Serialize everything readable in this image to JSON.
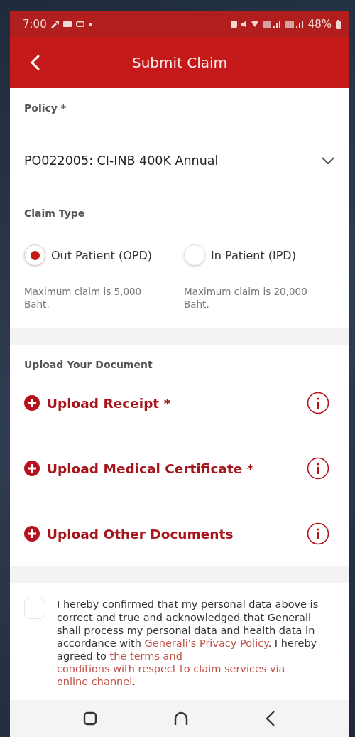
{
  "status_bar": {
    "time": "7:00",
    "battery": "48%"
  },
  "header": {
    "title": "Submit Claim"
  },
  "policy": {
    "label": "Policy *",
    "value": "PO022005: CI-INB 400K Annual"
  },
  "claim_type": {
    "label": "Claim Type",
    "options": [
      {
        "label": "Out Patient (OPD)",
        "note": "Maximum claim is 5,000 Baht.",
        "selected": true
      },
      {
        "label": "In Patient (IPD)",
        "note": "Maximum claim is 20,000 Baht.",
        "selected": false
      }
    ]
  },
  "upload": {
    "label": "Upload Your Document",
    "items": [
      {
        "label": "Upload Receipt *"
      },
      {
        "label": "Upload Medical Certificate *"
      },
      {
        "label": "Upload Other Documents"
      }
    ]
  },
  "consent": {
    "checked": false,
    "parts": [
      {
        "kind": "plain",
        "text": "I hereby confirmed that my personal data above is correct and true and acknowledged that Generali shall process my personal data and health data in accordance with "
      },
      {
        "kind": "link",
        "text": "Generali's"
      },
      {
        "kind": "link",
        "text": "Privacy Policy"
      },
      {
        "kind": "plain",
        "text": ". I hereby agreed to "
      },
      {
        "kind": "link",
        "text": "the terms and"
      },
      {
        "kind": "link",
        "text": "conditions with respect to claim services via"
      },
      {
        "kind": "link",
        "text": "online channel"
      },
      {
        "kind": "plain",
        "text": "."
      }
    ]
  }
}
